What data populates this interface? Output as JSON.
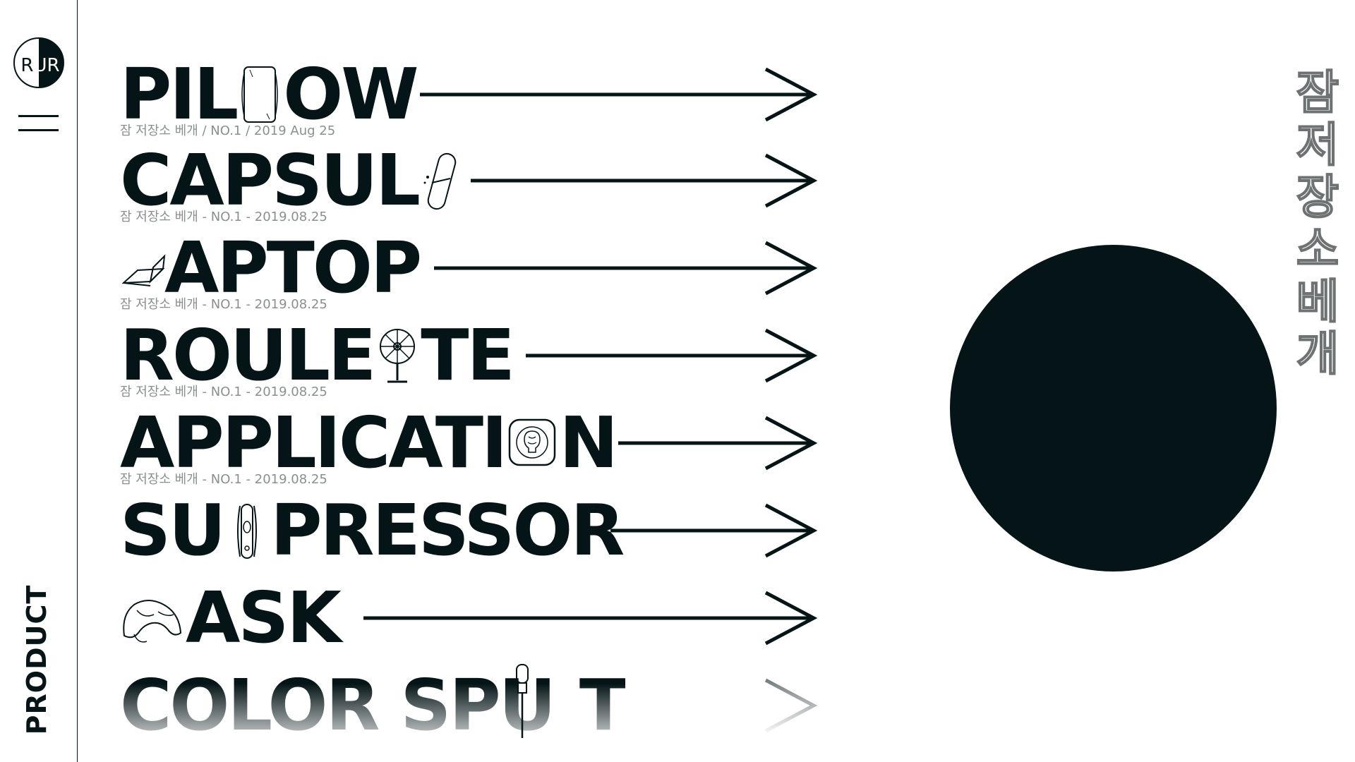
{
  "brand": {
    "logo_text": "RUR"
  },
  "sidebar": {
    "section_label": "PRODUCT"
  },
  "products": [
    {
      "title_before": "PIL",
      "title_after": "OW",
      "icon": "pillow-icon",
      "subtitle": "잠 저장소 베개 / NO.1 / 2019 Aug 25"
    },
    {
      "title_before": "CAPSUL",
      "title_after": "",
      "icon": "capsule-icon",
      "subtitle": "잠 저장소 베개 - NO.1 - 2019.08.25"
    },
    {
      "title_before": "",
      "title_after": "APTOP",
      "icon": "laptop-icon",
      "subtitle": "잠 저장소 베개 - NO.1 - 2019.08.25"
    },
    {
      "title_before": "ROULE",
      "title_after": "TE",
      "icon": "roulette-icon",
      "subtitle": "잠 저장소 베개 - NO.1 - 2019.08.25"
    },
    {
      "title_before": "APPLICATI",
      "title_after": "N",
      "icon": "brain-app-icon",
      "subtitle": "잠 저장소 베개 - NO.1 - 2019.08.25"
    },
    {
      "title_before": "SU",
      "title_after": "PRESSOR",
      "icon": "suppressor-icon",
      "subtitle": ""
    },
    {
      "title_before": "",
      "title_after": "ASK",
      "icon": "mask-icon",
      "subtitle": ""
    },
    {
      "title_before": "COLOR SPU",
      "title_after": "T",
      "icon": "pipette-icon",
      "subtitle": ""
    }
  ],
  "hero": {
    "vertical_title": "잠 저장소 베개"
  },
  "colors": {
    "ink": "#051517",
    "muted_text": "#8a8f90",
    "background": "#ffffff"
  }
}
